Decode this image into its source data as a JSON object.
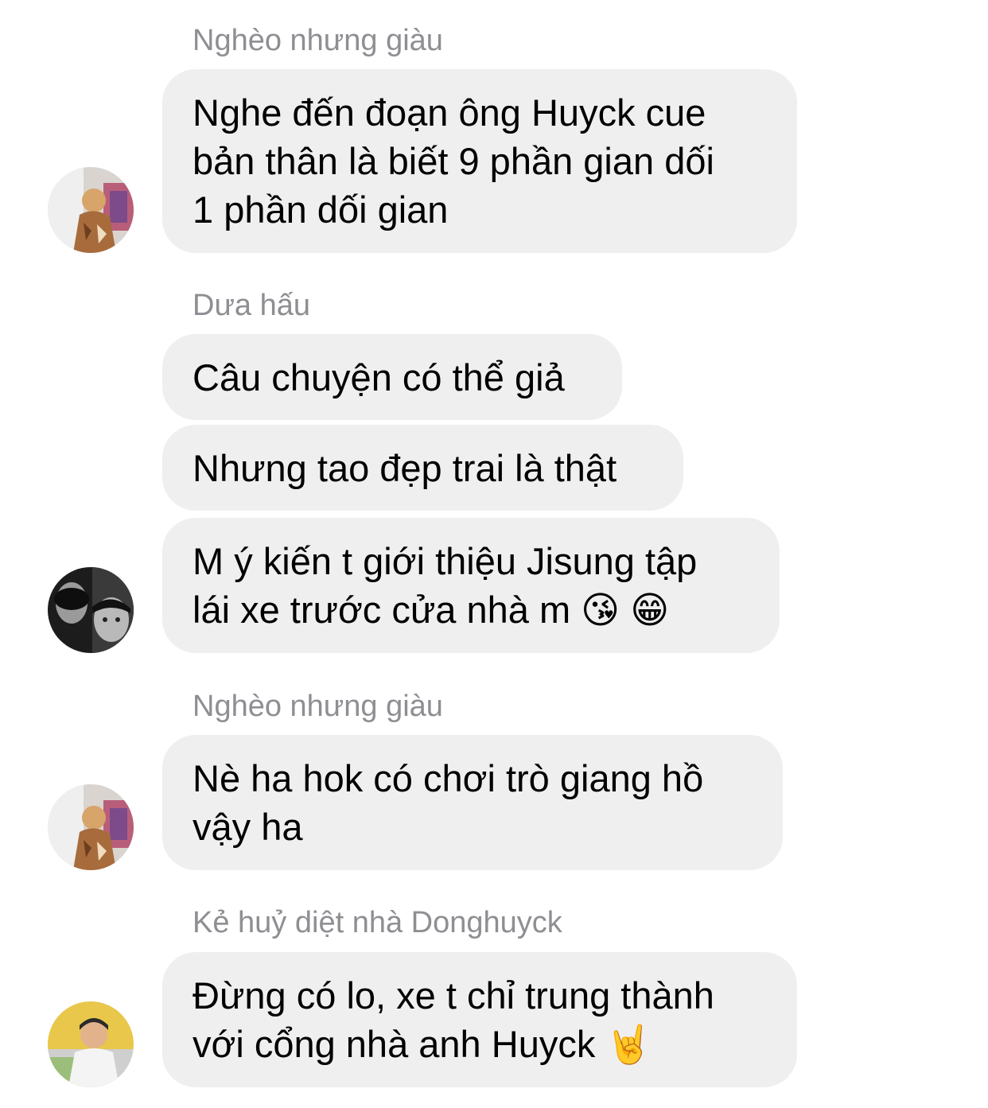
{
  "chat": {
    "groups": [
      {
        "sender": "Nghèo nhưng giàu",
        "avatar": "person-avatar-photo",
        "messages": [
          "Nghe đến đoạn ông Huyck cue\nbản thân là biết 9 phần gian dối\n1 phần dối gian"
        ]
      },
      {
        "sender": "Dưa hấu",
        "avatar": "bw-selfie-avatar-photo",
        "messages": [
          "Câu chuyện có thể giả",
          "Nhưng tao đẹp trai là thật",
          "M ý kiến t giới thiệu Jisung tập\nlái xe trước cửa nhà m 😘 😁"
        ]
      },
      {
        "sender": "Nghèo nhưng giàu",
        "avatar": "person-avatar-photo",
        "messages": [
          "Nè ha hok có chơi trò giang hồ\nvậy ha"
        ]
      },
      {
        "sender": "Kẻ huỷ diệt nhà Donghuyck",
        "avatar": "kid-avatar-photo",
        "messages": [
          "Đừng có lo, xe t chỉ trung thành\nvới cổng nhà anh Huyck 🤘"
        ]
      }
    ]
  },
  "colors": {
    "bubble_bg": "#efefef",
    "sender_text": "#8e8e93",
    "message_text": "#000000",
    "background": "#ffffff"
  }
}
